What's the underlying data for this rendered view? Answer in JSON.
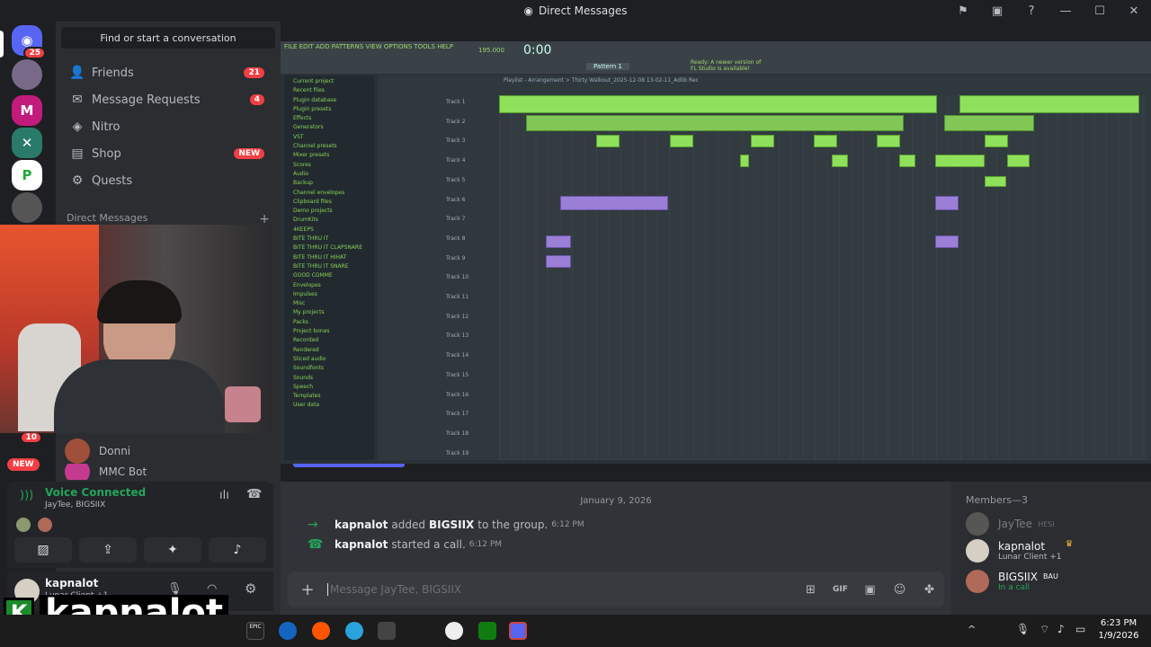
{
  "window": {
    "title": "Direct Messages"
  },
  "rail": {
    "home_badge": "25",
    "badge2": "10",
    "new_label": "NEW"
  },
  "sidebar": {
    "search_placeholder": "Find or start a conversation",
    "nav": [
      {
        "label": "Friends",
        "badge": "21"
      },
      {
        "label": "Message Requests",
        "badge": "4"
      },
      {
        "label": "Nitro"
      },
      {
        "label": "Shop",
        "badge": "NEW"
      },
      {
        "label": "Quests"
      }
    ],
    "dm_header": "Direct Messages",
    "dm_users": [
      "Donni",
      "MMC Bot"
    ]
  },
  "voice": {
    "title": "Voice Connected",
    "subtitle": "JayTee, BIGSIIX"
  },
  "user": {
    "name": "kapnalot",
    "status": "Lunar Client +1",
    "overlay_name": "kapnalot"
  },
  "fl": {
    "menu": "FILE EDIT ADD PATTERNS VIEW OPTIONS TOOLS HELP",
    "time": "0:00",
    "tempo": "195.000",
    "pattern": "Pattern 1",
    "notice": "Ready: A newer version of FL Studio is available!",
    "playlist_title": "Playlist - Arrangement > Thirty Walkout_2025-12-08 13-02-11_Adlib Rec",
    "browser_items": [
      "Current project",
      "Recent files",
      "Plugin database",
      "Plugin presets",
      "Effects",
      "Generators",
      "VST",
      "Channel presets",
      "Mixer presets",
      "Scores",
      "Audio",
      "Backup",
      "Channel envelopes",
      "Clipboard files",
      "Demo projects",
      "DrumKits",
      "4KEEPS",
      "BITE THRU IT",
      "BITE THRU IT CLAPSNARE",
      "BITE THRU IT HIHAT",
      "BITE THRU IT SNARE",
      "GOOD COMME",
      "Envelopes",
      "Impulses",
      "Misc",
      "My projects",
      "Packs",
      "Project bones",
      "Recorded",
      "Rendered",
      "Sliced audio",
      "Soundfonts",
      "Sounds",
      "Speech",
      "Templates",
      "User data"
    ],
    "tracks": [
      "Track 1",
      "Track 2",
      "Track 3",
      "Track 4",
      "Track 5",
      "Track 6",
      "Track 7",
      "Track 8",
      "Track 9",
      "Track 10",
      "Track 11",
      "Track 12",
      "Track 13",
      "Track 14",
      "Track 15",
      "Track 16",
      "Track 17",
      "Track 18",
      "Track 19"
    ]
  },
  "chat": {
    "date": "January 9, 2026",
    "messages": [
      {
        "actor": "kapnalot",
        "text": "added",
        "target": "BIGSIIX",
        "rest": "to the group.",
        "time": "6:12 PM"
      },
      {
        "actor": "kapnalot",
        "text": "started a call.",
        "time": "6:12 PM"
      }
    ],
    "input_placeholder": "Message JayTee, BIGSIIX"
  },
  "members": {
    "header": "Members—3",
    "list": [
      {
        "name": "JayTee",
        "tag": "HESI",
        "status": ""
      },
      {
        "name": "kapnalot",
        "tag": "",
        "status": "Lunar Client +1"
      },
      {
        "name": "BIGSIIX",
        "tag": "BAU",
        "status": "In a call"
      }
    ]
  },
  "taskbar": {
    "time": "6:23 PM",
    "date": "1/9/2026"
  }
}
